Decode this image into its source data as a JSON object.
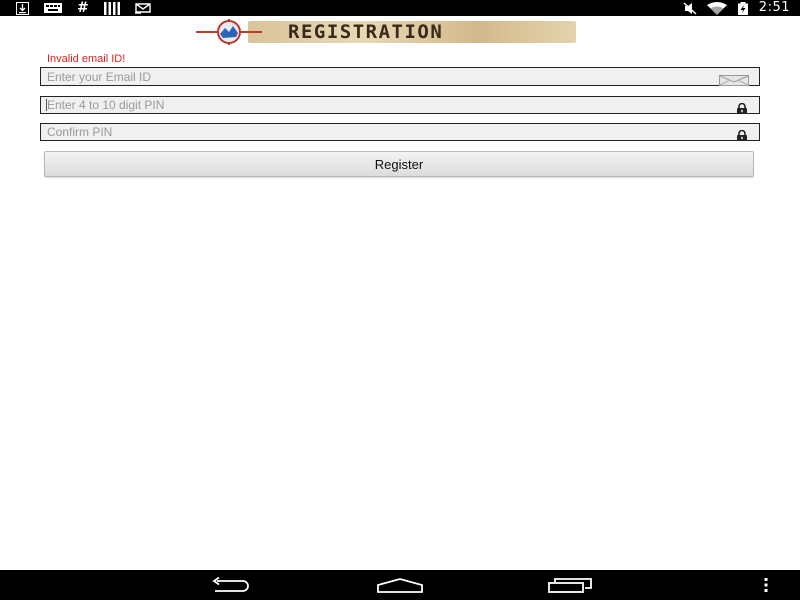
{
  "status_bar": {
    "time": "2:51",
    "left_icons": [
      "download-icon",
      "keyboard-icon",
      "hash-icon",
      "signal-bars-icon",
      "check-mail-icon"
    ],
    "right_icons": [
      "mute-icon",
      "wifi-icon",
      "battery-charging-icon"
    ],
    "hash_glyph": "#"
  },
  "banner": {
    "title": "REGISTRATION",
    "icon": "globe-crosshair-icon"
  },
  "form": {
    "error_message": "Invalid email ID!",
    "email": {
      "placeholder": "Enter your Email ID",
      "value": "",
      "icon": "envelope-icon"
    },
    "pin": {
      "placeholder": "Enter 4 to 10 digit PIN",
      "value": "",
      "icon": "lock-icon",
      "focused": true
    },
    "confirm_pin": {
      "placeholder": "Confirm PIN",
      "value": "",
      "icon": "lock-icon"
    },
    "register_label": "Register"
  },
  "nav_bar": {
    "buttons": [
      "back-icon",
      "home-icon",
      "recents-icon",
      "overflow-menu-icon"
    ]
  },
  "colors": {
    "error": "#e0201b",
    "field_bg": "#f0f0f0",
    "bar_bg": "#000000"
  }
}
